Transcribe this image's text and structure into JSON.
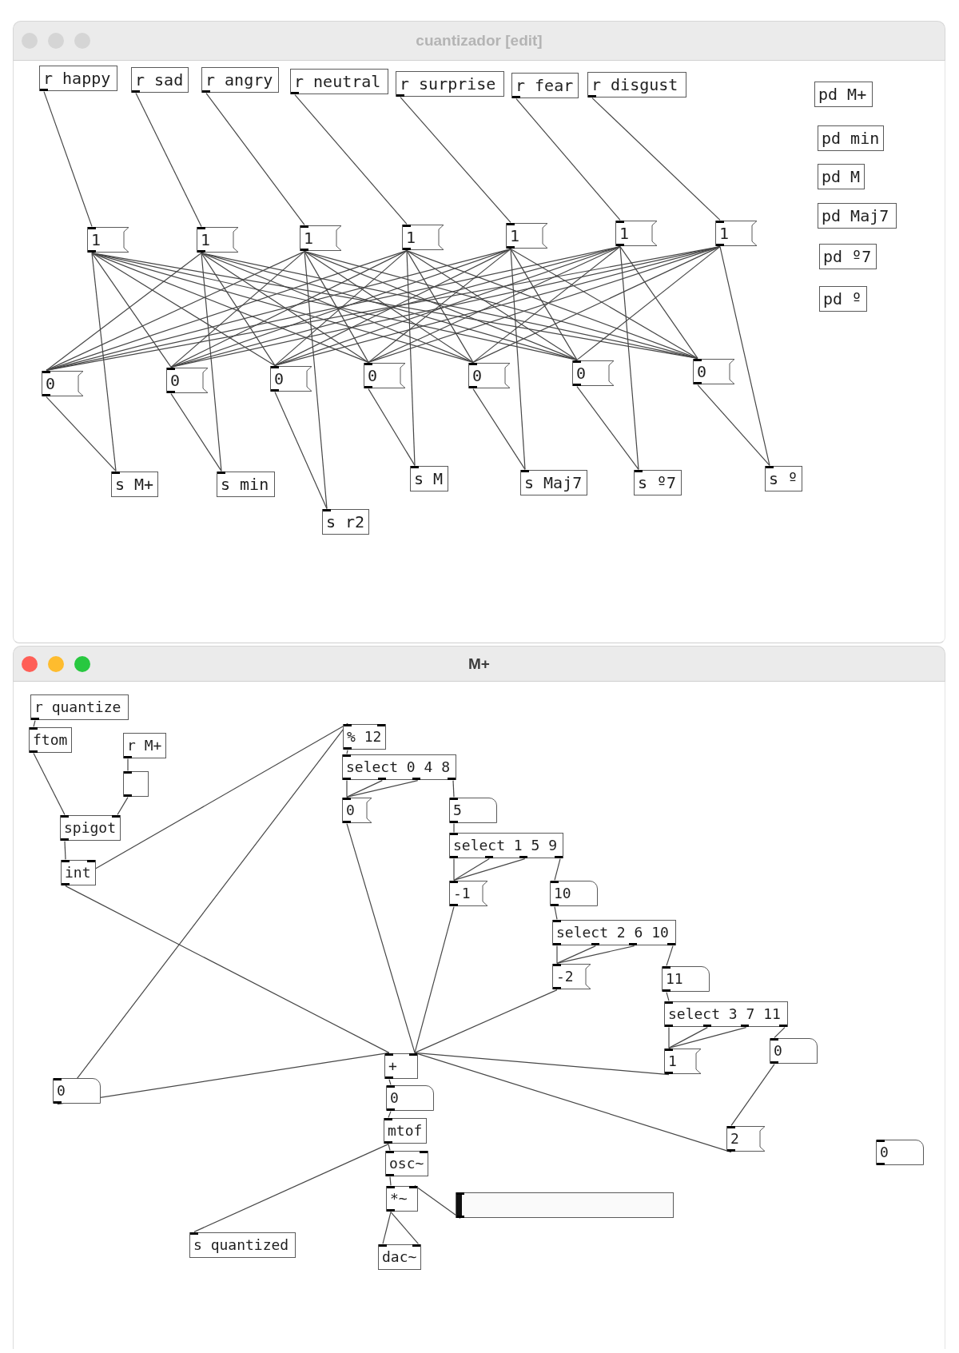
{
  "windows": [
    {
      "title": "cuantizador [edit]",
      "active": false,
      "objects": [
        {
          "kind": "object",
          "text": "r happy"
        },
        {
          "kind": "object",
          "text": "r sad"
        },
        {
          "kind": "object",
          "text": "r angry"
        },
        {
          "kind": "object",
          "text": "r neutral"
        },
        {
          "kind": "object",
          "text": "r surprise"
        },
        {
          "kind": "object",
          "text": "r fear"
        },
        {
          "kind": "object",
          "text": "r disgust"
        },
        {
          "kind": "object",
          "text": "pd M+"
        },
        {
          "kind": "object",
          "text": "pd min"
        },
        {
          "kind": "object",
          "text": "pd M"
        },
        {
          "kind": "object",
          "text": "pd Maj7"
        },
        {
          "kind": "object",
          "text": "pd º7"
        },
        {
          "kind": "object",
          "text": "pd º"
        },
        {
          "kind": "message",
          "text": "1"
        },
        {
          "kind": "message",
          "text": "1"
        },
        {
          "kind": "message",
          "text": "1"
        },
        {
          "kind": "message",
          "text": "1"
        },
        {
          "kind": "message",
          "text": "1"
        },
        {
          "kind": "message",
          "text": "1"
        },
        {
          "kind": "message",
          "text": "1"
        },
        {
          "kind": "message",
          "text": "0"
        },
        {
          "kind": "message",
          "text": "0"
        },
        {
          "kind": "message",
          "text": "0"
        },
        {
          "kind": "message",
          "text": "0"
        },
        {
          "kind": "message",
          "text": "0"
        },
        {
          "kind": "message",
          "text": "0"
        },
        {
          "kind": "message",
          "text": "0"
        },
        {
          "kind": "object",
          "text": "s M+"
        },
        {
          "kind": "object",
          "text": "s min"
        },
        {
          "kind": "object",
          "text": "s r2"
        },
        {
          "kind": "object",
          "text": "s M"
        },
        {
          "kind": "object",
          "text": "s Maj7"
        },
        {
          "kind": "object",
          "text": "s º7"
        },
        {
          "kind": "object",
          "text": "s º"
        }
      ]
    },
    {
      "title": "M+",
      "active": true,
      "objects": [
        {
          "kind": "object",
          "text": "r quantize"
        },
        {
          "kind": "object",
          "text": "ftom"
        },
        {
          "kind": "object",
          "text": "r M+"
        },
        {
          "kind": "toggle",
          "checked": false
        },
        {
          "kind": "object",
          "text": "spigot"
        },
        {
          "kind": "object",
          "text": "int"
        },
        {
          "kind": "object",
          "text": "% 12"
        },
        {
          "kind": "object",
          "text": "select 0 4 8"
        },
        {
          "kind": "message",
          "text": "0"
        },
        {
          "kind": "number",
          "text": "5"
        },
        {
          "kind": "object",
          "text": "select 1 5 9"
        },
        {
          "kind": "message",
          "text": "-1"
        },
        {
          "kind": "number",
          "text": "10"
        },
        {
          "kind": "object",
          "text": "select 2 6 10"
        },
        {
          "kind": "message",
          "text": "-2"
        },
        {
          "kind": "number",
          "text": "11"
        },
        {
          "kind": "object",
          "text": "select 3 7 11"
        },
        {
          "kind": "message",
          "text": "1"
        },
        {
          "kind": "number",
          "text": "0"
        },
        {
          "kind": "number",
          "text": "0"
        },
        {
          "kind": "object",
          "text": "+"
        },
        {
          "kind": "message",
          "text": "2"
        },
        {
          "kind": "number",
          "text": "0"
        },
        {
          "kind": "object",
          "text": "mtof"
        },
        {
          "kind": "number",
          "text": "0"
        },
        {
          "kind": "object",
          "text": "osc~"
        },
        {
          "kind": "object",
          "text": "*~"
        },
        {
          "kind": "slider",
          "level": 0
        },
        {
          "kind": "object",
          "text": "s quantized"
        },
        {
          "kind": "object",
          "text": "dac~"
        }
      ]
    }
  ]
}
